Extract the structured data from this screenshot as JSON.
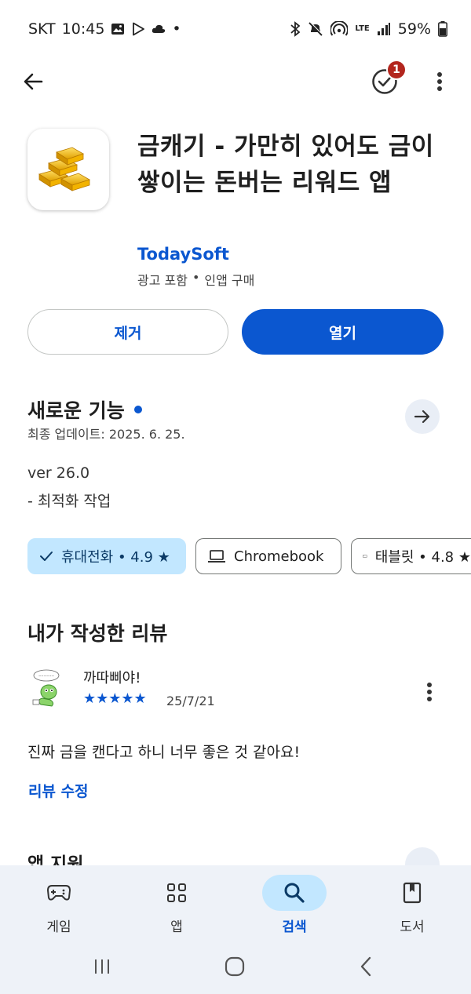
{
  "status_bar": {
    "carrier": "SKT",
    "time": "10:45",
    "network": "LTE",
    "battery": "59%",
    "dot": "•"
  },
  "header": {
    "notification_count": "1"
  },
  "app": {
    "title": "금캐기 - 가만히 있어도 금이 쌓이는 돈버는 리워드 앱",
    "developer": "TodaySoft",
    "meta_ads": "광고 포함",
    "meta_sep": "•",
    "meta_iap": "인앱 구매",
    "uninstall_label": "제거",
    "open_label": "열기"
  },
  "whats_new": {
    "title": "새로운 기능",
    "updated": "최종 업데이트: 2025. 6. 25.",
    "version": "ver 26.0",
    "notes": "- 최적화 작업"
  },
  "device_chips": [
    {
      "label": "휴대전화 • 4.9 ★",
      "selected": true,
      "icon": "check-icon"
    },
    {
      "label": "Chromebook",
      "selected": false,
      "icon": "laptop-icon"
    },
    {
      "label": "태블릿 • 4.8 ★",
      "selected": false,
      "icon": "tablet-icon"
    }
  ],
  "my_review": {
    "section_title": "내가 작성한 리뷰",
    "author": "까따삐야!",
    "stars": "★★★★★",
    "rating": 5,
    "date": "25/7/21",
    "text": "진짜 금을 캔다고 하니 너무 좋은 것 같아요!",
    "edit_label": "리뷰 수정"
  },
  "next_section": {
    "title": "앱 지원"
  },
  "bottom_nav": [
    {
      "label": "게임",
      "icon": "gamepad-icon",
      "active": false
    },
    {
      "label": "앱",
      "icon": "apps-grid-icon",
      "active": false
    },
    {
      "label": "검색",
      "icon": "search-icon",
      "active": true
    },
    {
      "label": "도서",
      "icon": "book-icon",
      "active": false
    }
  ],
  "colors": {
    "accent": "#0b57d0",
    "chip_selected": "#c2e7ff",
    "badge": "#b3261e",
    "nav_background": "#eef2f8"
  }
}
